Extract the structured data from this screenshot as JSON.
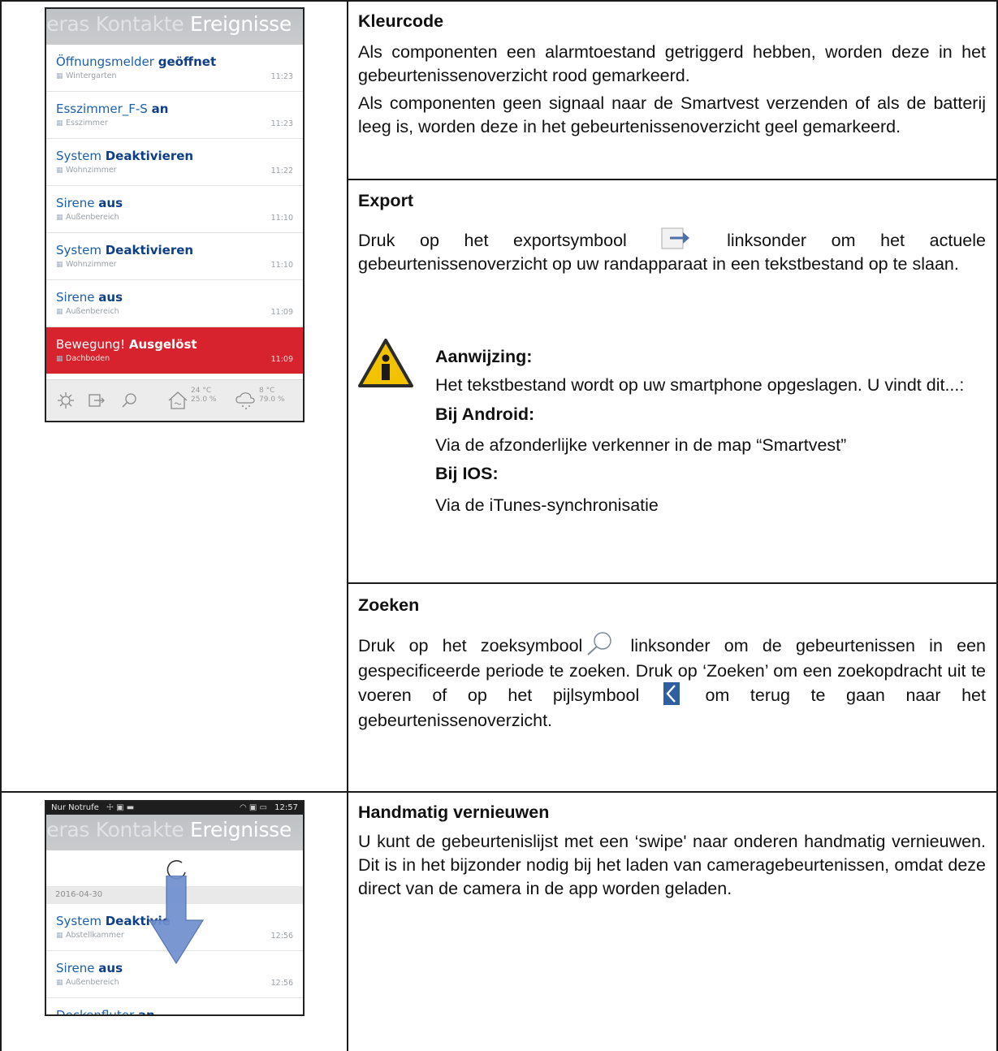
{
  "phone1": {
    "tabs_dim": "eras Kontakte",
    "tab_active": "Ereignisse",
    "events": [
      {
        "title": "Öffnungsmelder",
        "state": "geöffnet",
        "room": "Wintergarten",
        "time": "11:23",
        "alarm": false
      },
      {
        "title": "Esszimmer_F-S",
        "state": "an",
        "room": "Esszimmer",
        "time": "11:23",
        "alarm": false
      },
      {
        "title": "System",
        "state": "Deaktivieren",
        "room": "Wohnzimmer",
        "time": "11:22",
        "alarm": false
      },
      {
        "title": "Sirene",
        "state": "aus",
        "room": "Außenbereich",
        "time": "11:10",
        "alarm": false
      },
      {
        "title": "System",
        "state": "Deaktivieren",
        "room": "Wohnzimmer",
        "time": "11:10",
        "alarm": false
      },
      {
        "title": "Sirene",
        "state": "aus",
        "room": "Außenbereich",
        "time": "11:09",
        "alarm": false
      },
      {
        "title": "Bewegung!",
        "state": "Ausgelöst",
        "room": "Dachboden",
        "time": "11:09",
        "alarm": true
      }
    ],
    "weather_in": {
      "temp": "24 °C",
      "hum": "25.0 %"
    },
    "weather_out": {
      "temp": "8 °C",
      "hum": "79.0 %"
    }
  },
  "phone2": {
    "status_left": "Nur Notrufe",
    "status_time": "12:57",
    "tabs_dim": "eras Kontakte",
    "tab_active": "Ereignisse",
    "date": "2016-04-30",
    "events": [
      {
        "title": "System",
        "state": "Deaktivie",
        "room": "Abstellkammer",
        "time": "12:56"
      },
      {
        "title": "Sirene",
        "state": "aus",
        "room": "Außenbereich",
        "time": "12:56"
      },
      {
        "title": "Deckenfluter",
        "state": "an",
        "room": "",
        "time": ""
      }
    ]
  },
  "kleurcode": {
    "heading": "Kleurcode",
    "p1": "Als componenten een alarmtoestand getriggerd hebben, worden deze in het gebeurtenissenoverzicht rood gemarkeerd.",
    "p2": "Als componenten geen signaal naar de Smartvest verzenden of als de batterij leeg is, worden deze in het gebeurtenissenoverzicht geel gemarkeerd."
  },
  "export": {
    "heading": "Export",
    "p_before": "Druk op het exportsymbool",
    "p_after": "linksonder om het actuele gebeurtenissenoverzicht op uw randapparaat in een tekstbestand op te slaan.",
    "note_heading": "Aanwijzing:",
    "note_text": "Het tekstbestand wordt op uw smartphone opgeslagen. U vindt dit...:",
    "android_heading": "Bij Android:",
    "android_text": "Via de afzonderlijke verkenner in de map “Smartvest”",
    "ios_heading": "Bij IOS:",
    "ios_text": "Via de iTunes-synchronisatie"
  },
  "zoeken": {
    "heading": "Zoeken",
    "p_before": "Druk op het zoeksymbool",
    "p_mid": "linksonder om de gebeurtenissen in een gespecificeerde periode te zoeken. Druk op ‘Zoeken’ om een zoekopdracht uit te voeren of op het pijlsymbool",
    "p_after": "om terug te gaan naar het gebeurtenissenoverzicht."
  },
  "vernieuwen": {
    "heading": "Handmatig vernieuwen",
    "text": "U kunt de gebeurtenislijst met een ‘swipe' naar onderen handmatig vernieuwen. Dit is in het bijzonder nodig bij het laden van cameragebeurtenissen, omdat deze direct van de camera in de app worden geladen."
  },
  "colors": {
    "accent_blue": "#1d5fa8",
    "alarm_red": "#d7232e",
    "arrow_blue": "#6f8fcf"
  }
}
